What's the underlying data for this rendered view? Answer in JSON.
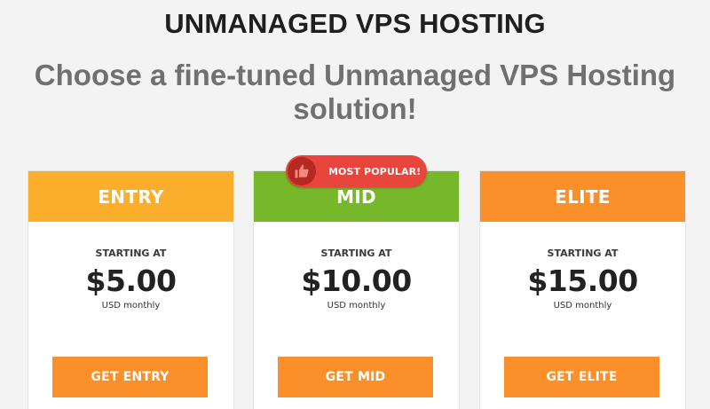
{
  "page": {
    "heading": "UNMANAGED VPS HOSTING",
    "subheading": "Choose a fine-tuned Unmanaged VPS Hosting solution!"
  },
  "badge": {
    "label": "MOST POPULAR!",
    "icon": "thumbs-up-icon",
    "color": "#e8453c"
  },
  "colors": {
    "button": "#fb8f2a",
    "entry_header": "#fbae2c",
    "mid_header": "#76b82a",
    "elite_header": "#fb8f2a"
  },
  "plans": [
    {
      "name": "ENTRY",
      "starting_label": "STARTING AT",
      "price": "$5.00",
      "period": "USD monthly",
      "button_label": "GET ENTRY"
    },
    {
      "name": "MID",
      "starting_label": "STARTING AT",
      "price": "$10.00",
      "period": "USD monthly",
      "button_label": "GET MID"
    },
    {
      "name": "ELITE",
      "starting_label": "STARTING AT",
      "price": "$15.00",
      "period": "USD monthly",
      "button_label": "GET ELITE"
    }
  ]
}
